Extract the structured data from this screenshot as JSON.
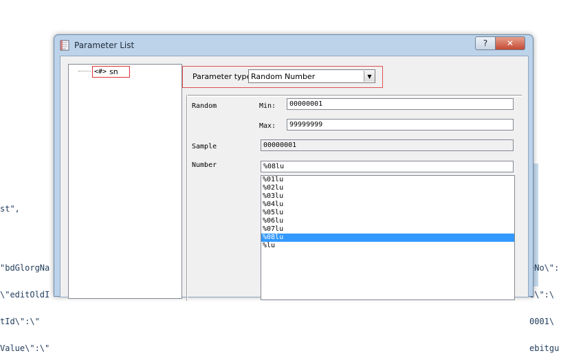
{
  "background": {
    "left_lines_a": [
      "st\","
    ],
    "left_lines_b": [
      "\"bdGlorgNa",
      "\\\"editOldI",
      "tId\\\":\\\"",
      "Value\\\":\\\""
    ],
    "right_lines": [
      "eNo\\\":",
      "d\\\":\\",
      "0001\\",
      "ebitgu"
    ]
  },
  "dialog": {
    "title": "Parameter List",
    "help_label": "?",
    "close_label": "✕"
  },
  "tree": {
    "items": [
      {
        "icon": "<#>",
        "label": "sn"
      }
    ]
  },
  "parameter_type": {
    "label": "Parameter type:",
    "value": "Random Number",
    "arrow": "▼"
  },
  "random": {
    "section_label": "Random",
    "min_label": "Min:",
    "min_value": "00000001",
    "max_label": "Max:",
    "max_value": "99999999"
  },
  "sample": {
    "label": "Sample",
    "value": "00000001"
  },
  "number": {
    "label": "Number",
    "value": "%08lu",
    "options": [
      "%01lu",
      "%02lu",
      "%03lu",
      "%04lu",
      "%05lu",
      "%06lu",
      "%07lu",
      "%08lu",
      "%lu"
    ],
    "selected": "%08lu"
  },
  "colors": {
    "selection": "#3399ff",
    "highlight_border": "#e05050"
  }
}
